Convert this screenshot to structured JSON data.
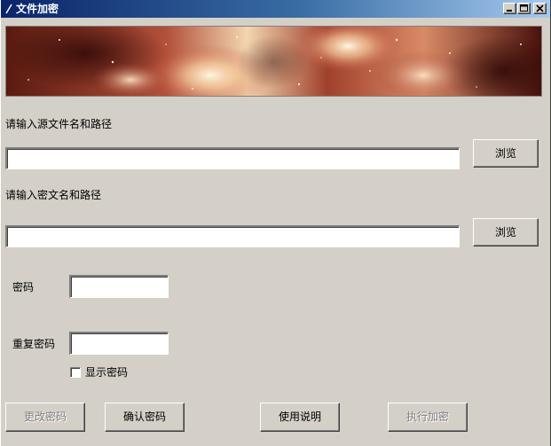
{
  "window": {
    "title": "文件加密",
    "controls": {
      "minimize": "minimize-icon",
      "maximize": "maximize-icon",
      "close": "close-icon"
    }
  },
  "colors": {
    "titlebar_start": "#0a246a",
    "titlebar_end": "#a6caf0",
    "face": "#d4d0c8",
    "disabled_text": "#808080"
  },
  "form": {
    "source_label": "请输入源文件名和路径",
    "source_value": "",
    "source_browse": "浏览",
    "cipher_label": "请输入密文名和路径",
    "cipher_value": "",
    "cipher_browse": "浏览",
    "password_label": "密码",
    "password_value": "",
    "repeat_label": "重复密码",
    "repeat_value": "",
    "show_password_label": "显示密码",
    "show_password_checked": false
  },
  "buttons": {
    "change_password": "更改密码",
    "confirm_password": "确认密码",
    "instructions": "使用说明",
    "execute_encrypt": "执行加密"
  }
}
